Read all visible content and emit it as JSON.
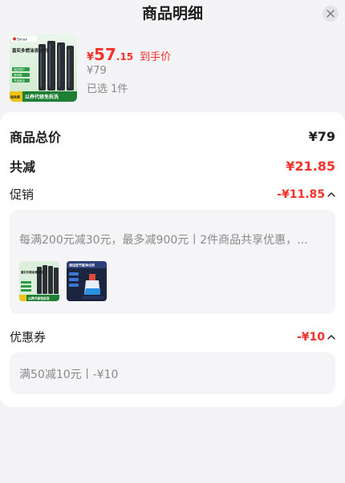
{
  "header": {
    "title": "商品明细"
  },
  "product": {
    "price_symbol": "¥",
    "price_int": "57",
    "price_dec": ".15",
    "price_tag": "到手价",
    "original_price": "¥79",
    "selected_count": "已选 1件"
  },
  "summary": {
    "total_label": "商品总价",
    "total_value": "¥79",
    "discount_label": "共减",
    "discount_value": "¥21.85"
  },
  "promotion": {
    "label": "促销",
    "value": "-¥11.85",
    "description": "每满200元减30元，最多减900元丨2件商品共享优惠，..."
  },
  "coupon": {
    "label": "优惠券",
    "value": "-¥10",
    "description": "满50减10元丨-¥10"
  },
  "thumb_text": {
    "brand": "Sonax",
    "product_name": "嘉实多燃油清洁剂",
    "features": [
      "深层养护",
      "清积碳",
      "节省燃油"
    ],
    "banner": "以养代修免拆洗",
    "badge": "组合装"
  },
  "thumb2_text": {
    "title": "添加型节能净化剂"
  },
  "colors": {
    "accent_red": "#f2322b",
    "gray_text": "#8a8a8a",
    "panel_bg": "#f5f5f7",
    "page_bg": "#f4f4f6"
  },
  "icons": [
    "close-icon",
    "chevron-up-icon"
  ]
}
